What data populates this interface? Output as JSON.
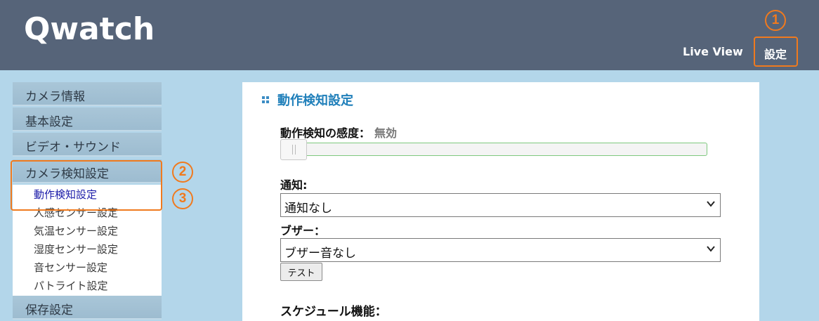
{
  "header": {
    "logo": "Qwatch",
    "nav": {
      "live_view": "Live View",
      "settings": "設定"
    }
  },
  "annotations": {
    "one": "1",
    "two": "2",
    "three": "3"
  },
  "sidebar": {
    "categories": [
      {
        "label": "カメラ情報"
      },
      {
        "label": "基本設定"
      },
      {
        "label": "ビデオ・サウンド"
      },
      {
        "label": "カメラ検知設定"
      },
      {
        "label": "保存設定"
      }
    ],
    "sub_items": [
      {
        "label": "動作検知設定",
        "active": true
      },
      {
        "label": "人感センサー設定"
      },
      {
        "label": "気温センサー設定"
      },
      {
        "label": "湿度センサー設定"
      },
      {
        "label": "音センサー設定"
      },
      {
        "label": "パトライト設定"
      }
    ]
  },
  "main": {
    "title": "動作検知設定",
    "sensitivity_label": "動作検知の感度：",
    "sensitivity_value": "無効",
    "sensitivity_level": 0,
    "notify_label": "通知:",
    "notify_value": "通知なし",
    "buzzer_label": "ブザー：",
    "buzzer_value": "ブザー音なし",
    "test_button": "テスト",
    "schedule_label": "スケジュール機能："
  },
  "colors": {
    "header_bg": "#566479",
    "page_bg": "#b3d6ea",
    "accent_blue": "#1f7fba",
    "annotation_orange": "#f07a1e",
    "active_link": "#1a1aa8"
  }
}
